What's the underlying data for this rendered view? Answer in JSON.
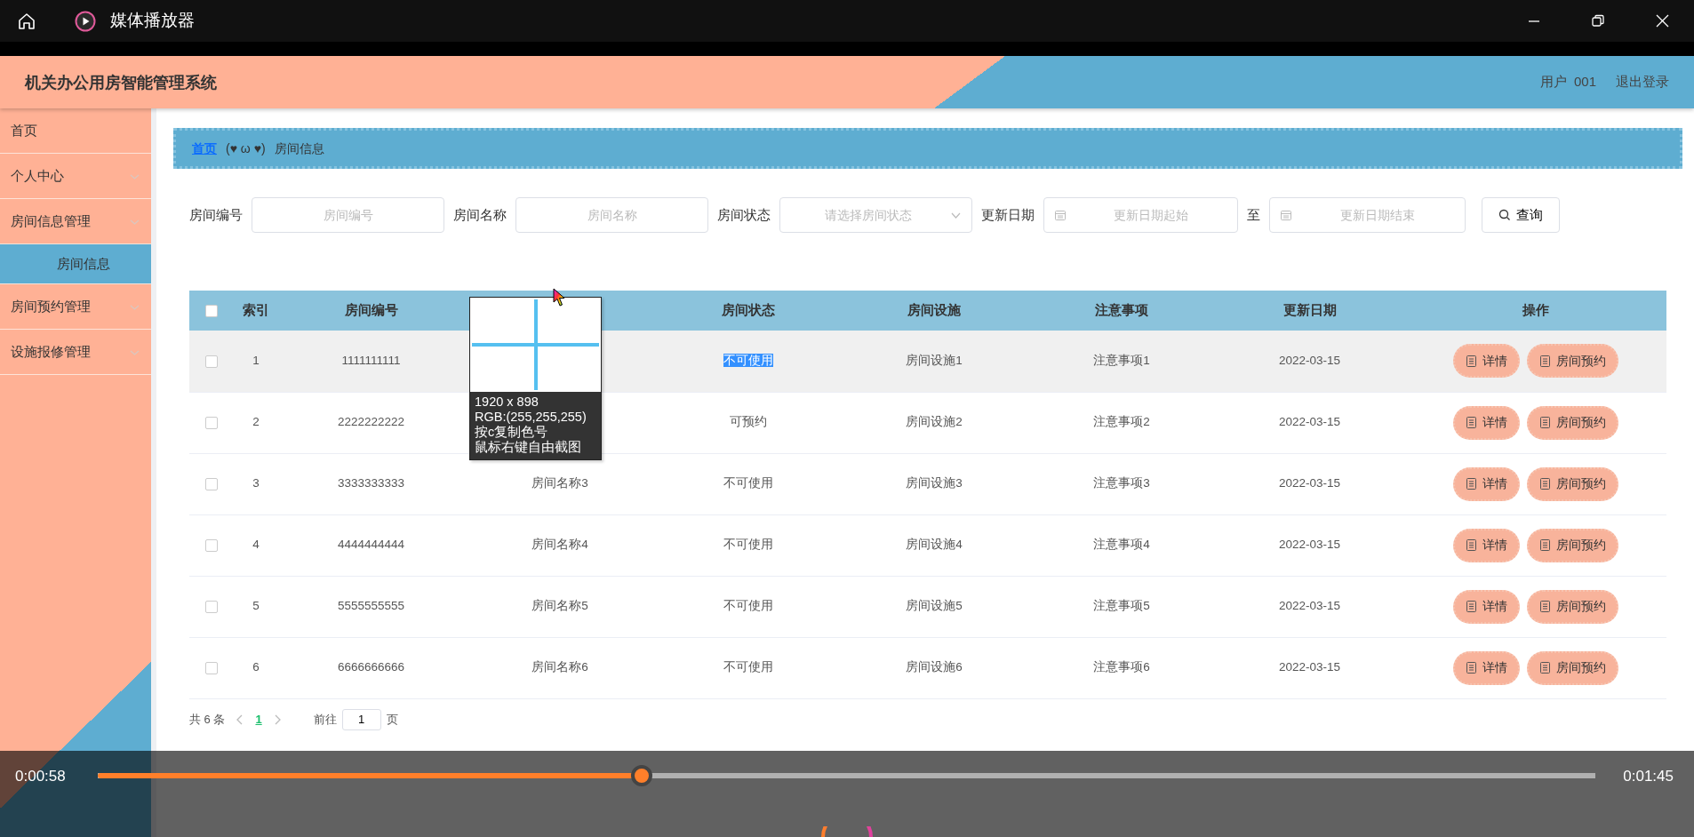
{
  "window": {
    "title": "媒体播放器"
  },
  "app": {
    "title": "机关办公用房智能管理系统",
    "user_label": "用户",
    "user_id": "001",
    "logout": "退出登录"
  },
  "sidebar": {
    "items": [
      {
        "label": "首页",
        "kind": "link",
        "selected": false
      },
      {
        "label": "个人中心",
        "kind": "group",
        "selected": false
      },
      {
        "label": "房间信息管理",
        "kind": "group",
        "selected": false,
        "children": [
          {
            "label": "房间信息",
            "selected": true
          }
        ]
      },
      {
        "label": "房间预约管理",
        "kind": "group",
        "selected": false
      },
      {
        "label": "设施报修管理",
        "kind": "group",
        "selected": false
      }
    ]
  },
  "breadcrumb": {
    "home": "首页",
    "separator": "(♥ ω ♥)",
    "current": "房间信息"
  },
  "filters": [
    {
      "label": "房间编号",
      "kind": "text",
      "placeholder": "房间编号"
    },
    {
      "label": "房间名称",
      "kind": "text",
      "placeholder": "房间名称"
    },
    {
      "label": "房间状态",
      "kind": "select",
      "placeholder": "请选择房间状态"
    },
    {
      "label": "更新日期",
      "kind": "date",
      "placeholder": "更新日期起始"
    },
    {
      "label": "至",
      "kind": "date",
      "placeholder": "更新日期结束"
    }
  ],
  "search_button": "查询",
  "table": {
    "all_checked": false,
    "columns": [
      "索引",
      "房间编号",
      "",
      "房间状态",
      "房间设施",
      "注意事项",
      "更新日期",
      "操作"
    ],
    "rows": [
      {
        "checked": false,
        "hover": true,
        "cells": [
          "1",
          "1111111111",
          "",
          "不可使用",
          "房间设施1",
          "注意事项1",
          "2022-03-15"
        ],
        "status_highlighted": true,
        "actions": [
          "详情",
          "房间预约"
        ]
      },
      {
        "checked": false,
        "hover": false,
        "cells": [
          "2",
          "2222222222",
          "",
          "可预约",
          "房间设施2",
          "注意事项2",
          "2022-03-15"
        ],
        "status_highlighted": false,
        "actions": [
          "详情",
          "房间预约"
        ]
      },
      {
        "checked": false,
        "hover": false,
        "cells": [
          "3",
          "3333333333",
          "房间名称3",
          "不可使用",
          "房间设施3",
          "注意事项3",
          "2022-03-15"
        ],
        "status_highlighted": false,
        "actions": [
          "详情",
          "房间预约"
        ]
      },
      {
        "checked": false,
        "hover": false,
        "cells": [
          "4",
          "4444444444",
          "房间名称4",
          "不可使用",
          "房间设施4",
          "注意事项4",
          "2022-03-15"
        ],
        "status_highlighted": false,
        "actions": [
          "详情",
          "房间预约"
        ]
      },
      {
        "checked": false,
        "hover": false,
        "cells": [
          "5",
          "5555555555",
          "房间名称5",
          "不可使用",
          "房间设施5",
          "注意事项5",
          "2022-03-15"
        ],
        "status_highlighted": false,
        "actions": [
          "详情",
          "房间预约"
        ]
      },
      {
        "checked": false,
        "hover": false,
        "cells": [
          "6",
          "6666666666",
          "房间名称6",
          "不可使用",
          "房间设施6",
          "注意事项6",
          "2022-03-15"
        ],
        "status_highlighted": false,
        "actions": [
          "详情",
          "房间预约"
        ]
      }
    ]
  },
  "pagination": {
    "total": "共 6 条",
    "pages": [
      {
        "label": "1",
        "selected": true
      }
    ],
    "goto_label": "前往",
    "goto_value": "1",
    "page_suffix": "页"
  },
  "color_picker": {
    "lines": [
      "1920 x 898",
      "RGB:(255,255,255)",
      "按c复制色号",
      "鼠标右键自由截图"
    ]
  },
  "player": {
    "elapsed": "0:00:58",
    "duration": "0:01:45",
    "level": 0.363
  }
}
